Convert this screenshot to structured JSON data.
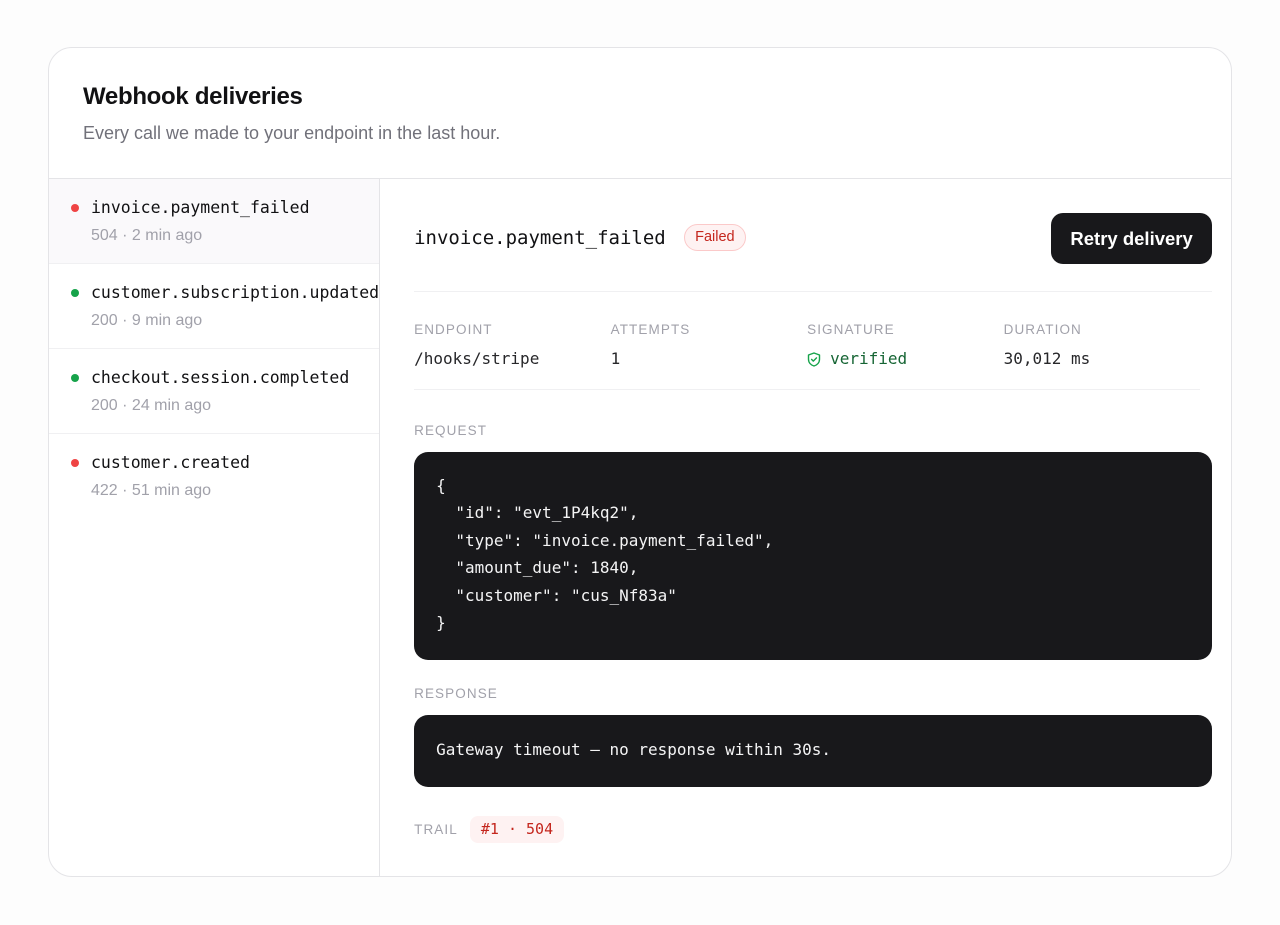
{
  "header": {
    "title": "Webhook deliveries",
    "subtitle": "Every call we made to your endpoint in the last hour."
  },
  "colors": {
    "failed": "#ef4444",
    "success": "#16a34a",
    "accent_dark": "#18181b"
  },
  "deliveries": [
    {
      "event": "invoice.payment_failed",
      "meta": "504 · 2 min ago",
      "status": "failed",
      "selected": true
    },
    {
      "event": "customer.subscription.updated",
      "meta": "200 · 9 min ago",
      "status": "success",
      "selected": false
    },
    {
      "event": "checkout.session.completed",
      "meta": "200 · 24 min ago",
      "status": "success",
      "selected": false
    },
    {
      "event": "customer.created",
      "meta": "422 · 51 min ago",
      "status": "failed",
      "selected": false
    }
  ],
  "detail": {
    "event": "invoice.payment_failed",
    "status_badge": "Failed",
    "retry_label": "Retry delivery",
    "meta": {
      "endpoint_label": "ENDPOINT",
      "endpoint_value": "/hooks/stripe",
      "attempts_label": "ATTEMPTS",
      "attempts_value": "1",
      "signature_label": "SIGNATURE",
      "signature_value": "verified",
      "signature_icon": "shield-check-icon",
      "duration_label": "DURATION",
      "duration_value": "30,012 ms"
    },
    "request_label": "REQUEST",
    "request_lines": [
      "{",
      "  \"id\": \"evt_1P4kq2\",",
      "  \"type\": \"invoice.payment_failed\",",
      "  \"amount_due\": 1840,",
      "  \"customer\": \"cus_Nf83a\"",
      "}"
    ],
    "response_label": "RESPONSE",
    "response_text": "Gateway timeout — no response within 30s.",
    "trail_label": "TRAIL",
    "trail_items": [
      "#1 · 504"
    ]
  }
}
